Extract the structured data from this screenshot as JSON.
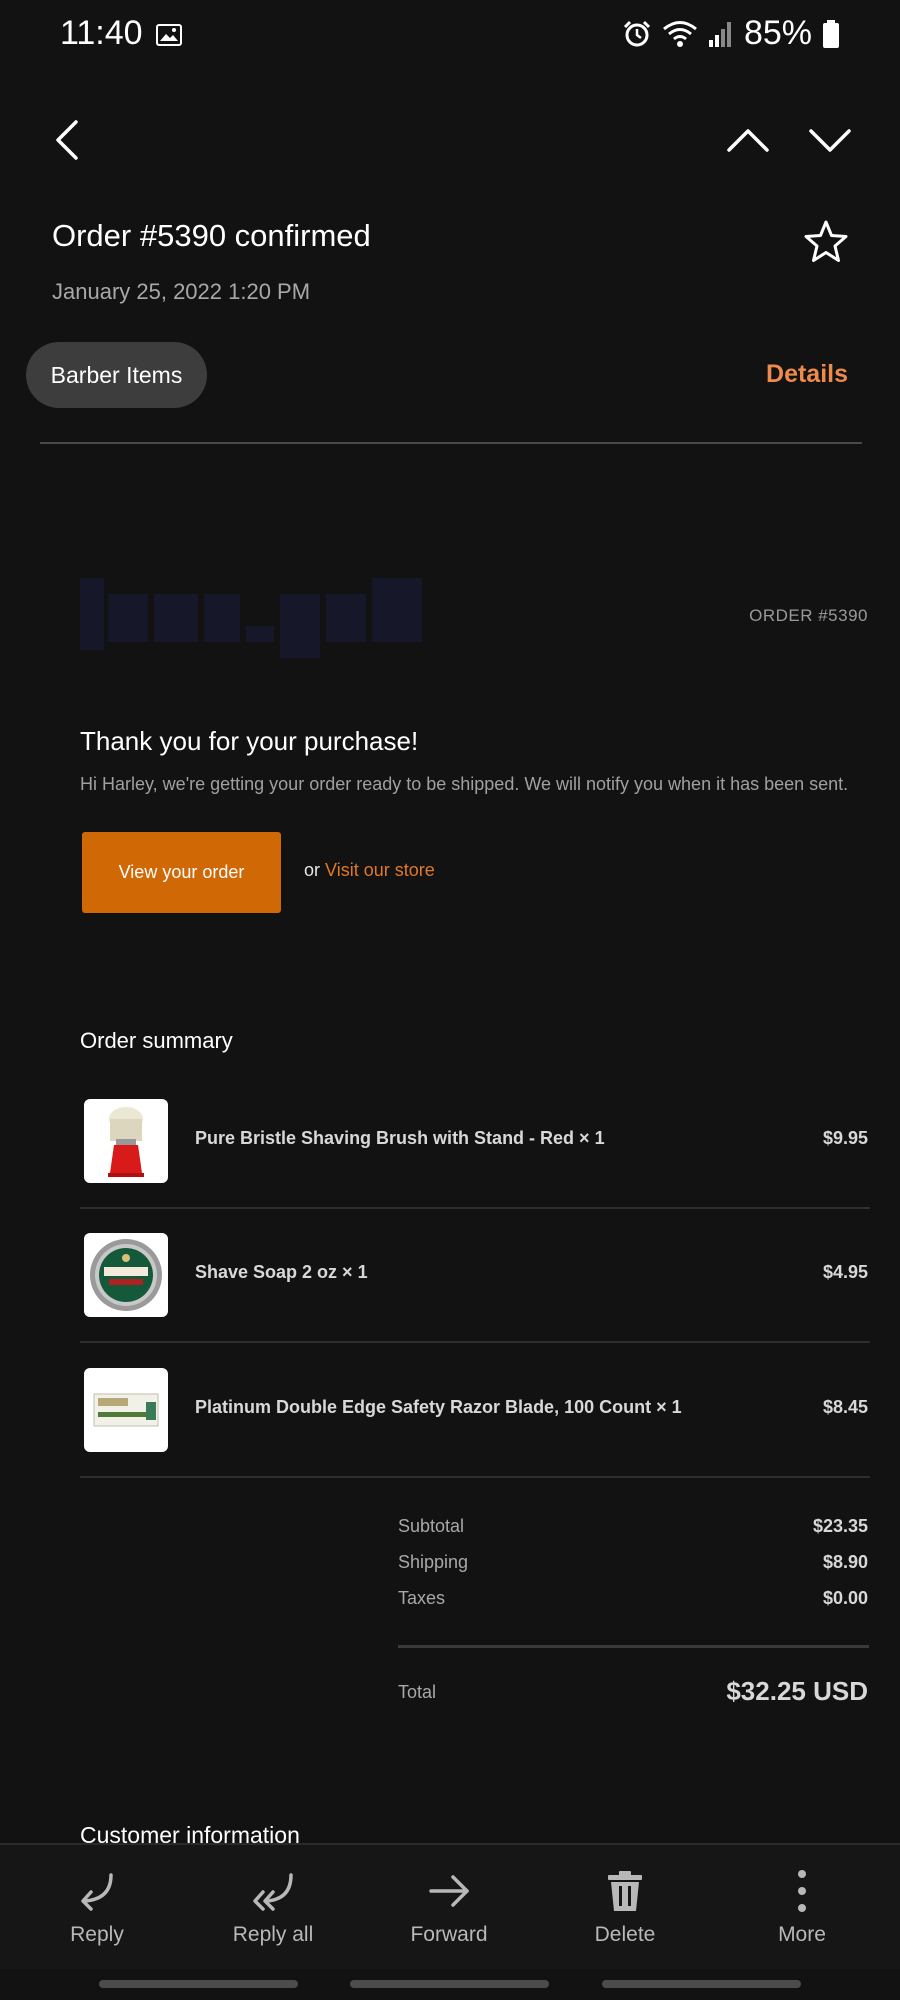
{
  "status_bar": {
    "time": "11:40",
    "battery": "85%"
  },
  "header": {
    "subject": "Order #5390 confirmed",
    "date": "January 25, 2022  1:20 PM",
    "label_chip": "Barber Items",
    "details_link": "Details"
  },
  "email": {
    "order_number": "ORDER #5390",
    "thanks_title": "Thank you for your purchase!",
    "thanks_text": "Hi Harley, we're getting your order ready to be shipped. We will notify you when it has been sent.",
    "view_order_button": "View your order",
    "or_text": "or ",
    "visit_store_link": "Visit our store",
    "summary_title": "Order summary",
    "items": [
      {
        "name": "Pure Bristle Shaving Brush with Stand - Red × 1",
        "price": "$9.95"
      },
      {
        "name": "Shave Soap 2 oz × 1",
        "price": "$4.95"
      },
      {
        "name": "Platinum Double Edge Safety Razor Blade, 100 Count × 1",
        "price": "$8.45"
      }
    ],
    "totals": {
      "subtotal_label": "Subtotal",
      "subtotal": "$23.35",
      "shipping_label": "Shipping",
      "shipping": "$8.90",
      "taxes_label": "Taxes",
      "taxes": "$0.00",
      "total_label": "Total",
      "total": "$32.25 USD"
    },
    "customer_info_title": "Customer information"
  },
  "toolbar": {
    "reply": "Reply",
    "reply_all": "Reply all",
    "forward": "Forward",
    "delete": "Delete",
    "more": "More"
  },
  "colors": {
    "accent": "#ee8a4a",
    "button": "#d06806",
    "background": "#121212"
  }
}
